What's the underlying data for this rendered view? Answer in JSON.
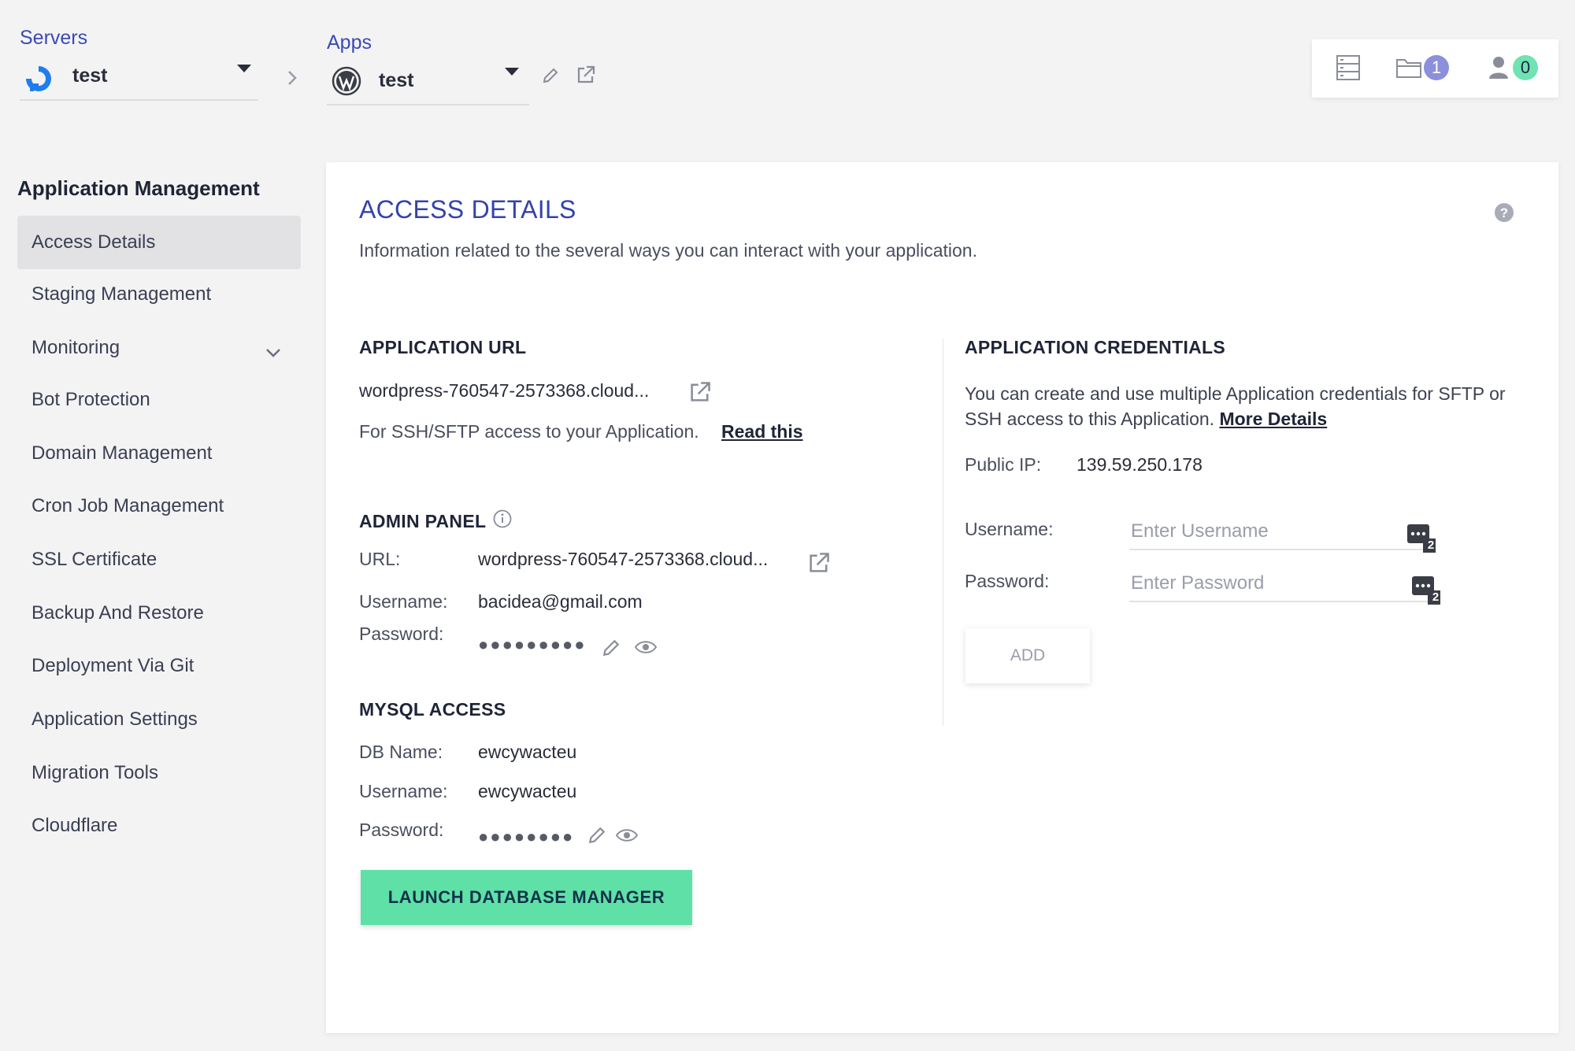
{
  "topbar": {
    "servers_label": "Servers",
    "server_name": "test",
    "apps_label": "Apps",
    "app_name": "test",
    "quick": {
      "files_count": "1",
      "team_count": "0"
    }
  },
  "sidebar": {
    "title": "Application Management",
    "items": [
      {
        "label": "Access Details",
        "active": true
      },
      {
        "label": "Staging Management"
      },
      {
        "label": "Monitoring",
        "expandable": true
      },
      {
        "label": "Bot Protection"
      },
      {
        "label": "Domain Management"
      },
      {
        "label": "Cron Job Management"
      },
      {
        "label": "SSL Certificate"
      },
      {
        "label": "Backup And Restore"
      },
      {
        "label": "Deployment Via Git"
      },
      {
        "label": "Application Settings"
      },
      {
        "label": "Migration Tools"
      },
      {
        "label": "Cloudflare"
      }
    ]
  },
  "main": {
    "title": "ACCESS DETAILS",
    "description": "Information related to the several ways you can interact with your application.",
    "app_url": {
      "heading": "APPLICATION URL",
      "url": "wordpress-760547-2573368.cloud...",
      "ssh_text": "For SSH/SFTP access to your Application.",
      "ssh_link": "Read this"
    },
    "admin_panel": {
      "heading": "ADMIN PANEL",
      "url_label": "URL:",
      "url": "wordpress-760547-2573368.cloud...",
      "username_label": "Username:",
      "username": "bacidea@gmail.com",
      "password_label": "Password:",
      "password_mask": "●●●●●●●●●"
    },
    "mysql": {
      "heading": "MYSQL ACCESS",
      "db_label": "DB Name:",
      "db_name": "ewcywacteu",
      "username_label": "Username:",
      "username": "ewcywacteu",
      "password_label": "Password:",
      "password_mask": "●●●●●●●●",
      "launch_button": "LAUNCH DATABASE MANAGER"
    },
    "credentials": {
      "heading": "APPLICATION CREDENTIALS",
      "text": "You can create and use multiple Application credentials for SFTP or SSH access to this Application.",
      "more_link": "More Details",
      "public_ip_label": "Public IP:",
      "public_ip": "139.59.250.178",
      "username_label": "Username:",
      "username_placeholder": "Enter Username",
      "password_label": "Password:",
      "password_placeholder": "Enter Password",
      "keychain_count": "2",
      "add_button": "ADD"
    }
  },
  "colors": {
    "accent": "#3443a8",
    "launch_button": "#5fe0a7",
    "files_badge": "#8b8fdc",
    "team_badge": "#6fe3b2"
  }
}
